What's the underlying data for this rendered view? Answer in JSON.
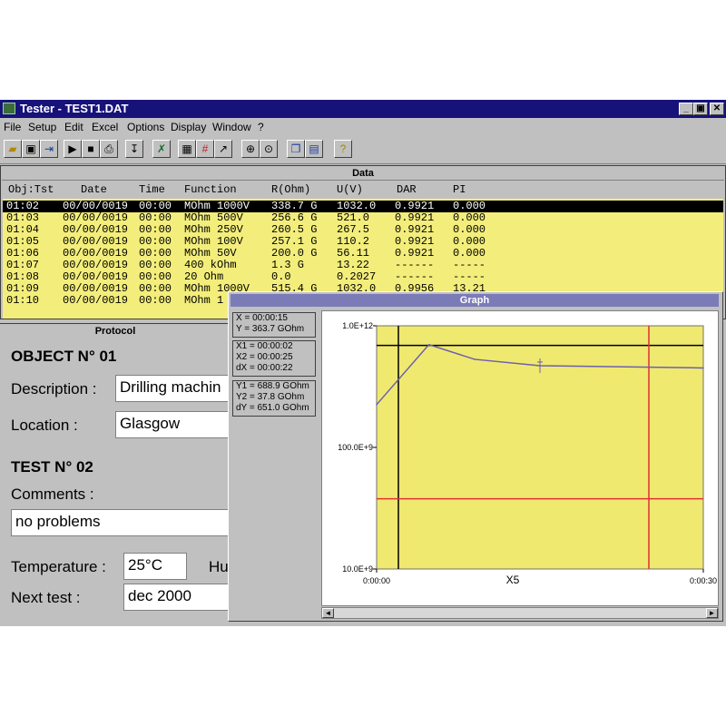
{
  "window": {
    "title": "Tester - TEST1.DAT",
    "controls": [
      "_",
      "▣",
      "✕"
    ]
  },
  "menu": [
    "File",
    "Setup",
    "Edit",
    "Excel",
    "Options",
    "Display",
    "Window",
    "?"
  ],
  "toolbar": [
    "open-icon",
    "save-icon",
    "import-icon",
    "play-icon",
    "stop-icon",
    "print-icon",
    "probe-icon",
    "tools-icon",
    "table-icon",
    "grid-icon",
    "curve-icon",
    "zoom-in-icon",
    "zoom-fit-icon",
    "window-cascade-icon",
    "window-tile-icon",
    "help-icon"
  ],
  "data_window": {
    "title": "Data",
    "columns": [
      "Obj:Tst",
      "Date",
      "Time",
      "Function",
      "R(Ohm)",
      "U(V)",
      "DAR",
      "PI"
    ],
    "rows": [
      [
        "01:02",
        "00/00/0019",
        "00:00",
        "MOhm 1000V",
        "338.7 G",
        "1032.0",
        "0.9921",
        "0.000"
      ],
      [
        "01:03",
        "00/00/0019",
        "00:00",
        "MOhm 500V",
        "256.6 G",
        "521.0",
        "0.9921",
        "0.000"
      ],
      [
        "01:04",
        "00/00/0019",
        "00:00",
        "MOhm 250V",
        "260.5 G",
        "267.5",
        "0.9921",
        "0.000"
      ],
      [
        "01:05",
        "00/00/0019",
        "00:00",
        "MOhm 100V",
        "257.1 G",
        "110.2",
        "0.9921",
        "0.000"
      ],
      [
        "01:06",
        "00/00/0019",
        "00:00",
        "MOhm 50V",
        "200.0 G",
        "56.11",
        "0.9921",
        "0.000"
      ],
      [
        "01:07",
        "00/00/0019",
        "00:00",
        "400 kOhm",
        "1.3 G",
        "13.22",
        "------",
        "-----"
      ],
      [
        "01:08",
        "00/00/0019",
        "00:00",
        "20 Ohm",
        "0.0",
        "0.2027",
        "------",
        "-----"
      ],
      [
        "01:09",
        "00/00/0019",
        "00:00",
        "MOhm 1000V",
        "515.4 G",
        "1032.0",
        "0.9956",
        "13.21"
      ],
      [
        "01:10",
        "00/00/0019",
        "00:00",
        "MOhm 1",
        "",
        "",
        "",
        ""
      ]
    ]
  },
  "protocol": {
    "title": "Protocol",
    "object_heading": "OBJECT N° 01",
    "description_label": "Description :",
    "description_value": "Drilling machin",
    "location_label": "Location :",
    "location_value": "Glasgow",
    "test_heading": "TEST N° 02",
    "comments_label": "Comments :",
    "comments_value": "no problems",
    "temperature_label": "Temperature :",
    "temperature_value": "25°C",
    "humidity_label_partial": "Hu",
    "next_test_label": "Next test :",
    "next_test_value": "dec 2000"
  },
  "graph_window": {
    "title": "Graph",
    "cursor": [
      "X = 00:00:15",
      "Y = 363.7 GOhm"
    ],
    "x_cursors": [
      "X1 = 00:00:02",
      "X2 = 00:00:25",
      "dX = 00:00:22"
    ],
    "y_cursors": [
      "Y1 = 688.9 GOhm",
      "Y2 = 37.8 GOhm",
      "dY = 651.0 GOhm"
    ],
    "zoom_label": "X5"
  },
  "chart_data": {
    "type": "line",
    "y_scale": "log",
    "ylim": [
      10000000000,
      1000000000000
    ],
    "xlim": [
      0,
      30
    ],
    "y_tick_labels": [
      "1.0E+12",
      "100.0E+9",
      "10.0E+9"
    ],
    "x_tick_labels": [
      "0:00:00",
      "0:00:30"
    ],
    "x_unit": "seconds",
    "background": "#f0e970",
    "series": [
      {
        "color": "#6b5fb0",
        "x": [
          0,
          4.8,
          9,
          15,
          30
        ],
        "y": [
          225000000000,
          700000000000,
          530000000000,
          470000000000,
          450000000000
        ]
      }
    ],
    "cursor_lines": {
      "color_x1y1": "#000000",
      "color_x2y2": "#e03030",
      "x1": 2,
      "x2": 25,
      "y1": 688900000000,
      "y2": 37800000000
    },
    "marker": {
      "x": 15,
      "y": 470000000000
    }
  }
}
